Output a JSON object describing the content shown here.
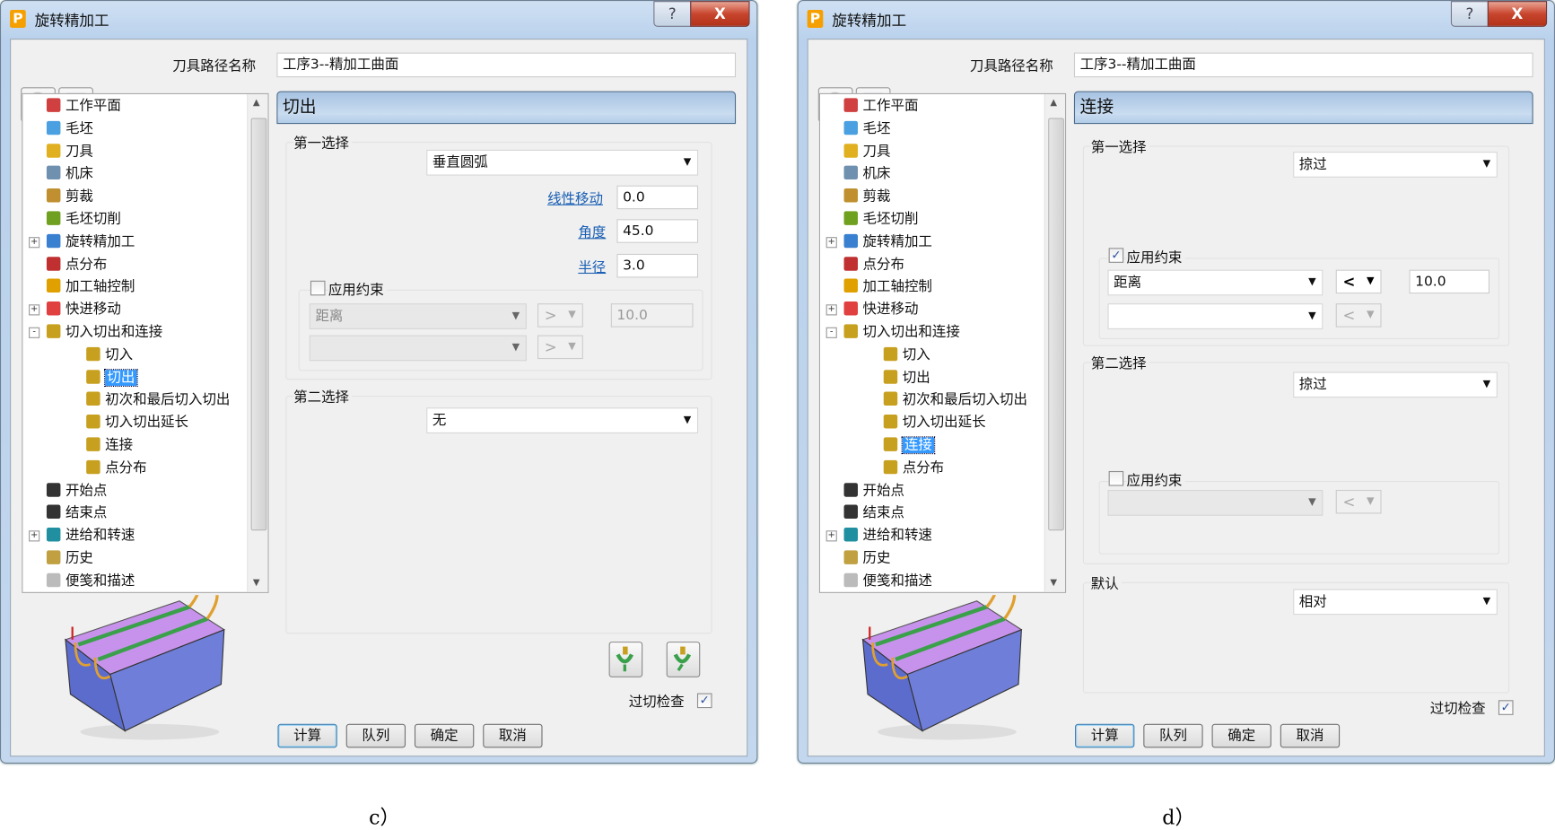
{
  "colors": {
    "accent": "#3399ff",
    "link": "#1a5fb4",
    "header": "#b3cde8"
  },
  "dialogs": [
    {
      "caption": "c）",
      "title": "旋转精加工",
      "help": "?",
      "close": "X",
      "path_label": "刀具路径名称",
      "path_value": "工序3--精加工曲面",
      "selected_index": 12,
      "header": "切出",
      "first_choice": {
        "label": "第一选择",
        "value": "垂直圆弧",
        "linear_label": "线性移动",
        "linear_value": "0.0",
        "angle_label": "角度",
        "angle_value": "45.0",
        "radius_label": "半径",
        "radius_value": "3.0",
        "constraint": {
          "label": "应用约束",
          "checked": false,
          "row1_combo": "距离",
          "row1_op": ">",
          "row1_value": "10.0",
          "row2_combo": "",
          "row2_op": ">"
        }
      },
      "second_choice": {
        "label": "第二选择",
        "value": "无"
      },
      "gouge_label": "过切检查",
      "gouge_checked": true,
      "buttons": {
        "calc": "计算",
        "queue": "队列",
        "ok": "确定",
        "cancel": "取消"
      }
    },
    {
      "caption": "d）",
      "title": "旋转精加工",
      "help": "?",
      "close": "X",
      "path_label": "刀具路径名称",
      "path_value": "工序3--精加工曲面",
      "selected_index": 14,
      "header": "连接",
      "first_choice": {
        "label": "第一选择",
        "value": "掠过",
        "constraint": {
          "label": "应用约束",
          "checked": true,
          "row1_combo": "距离",
          "row1_op": "<",
          "row1_value": "10.0",
          "row2_combo": "",
          "row2_op": "<"
        }
      },
      "second_choice": {
        "label": "第二选择",
        "value": "掠过",
        "constraint": {
          "label": "应用约束",
          "checked": false,
          "row1_combo": "",
          "row1_op": "<"
        }
      },
      "default": {
        "label": "默认",
        "value": "相对"
      },
      "gouge_label": "过切检查",
      "gouge_checked": true,
      "buttons": {
        "calc": "计算",
        "queue": "队列",
        "ok": "确定",
        "cancel": "取消"
      }
    }
  ],
  "tree": [
    {
      "label": "工作平面",
      "level": 0,
      "icon": "workplane-icon",
      "color": "#d04040"
    },
    {
      "label": "毛坯",
      "level": 0,
      "icon": "block-icon",
      "color": "#4aa0e0"
    },
    {
      "label": "刀具",
      "level": 0,
      "icon": "tool-icon",
      "color": "#e0b020"
    },
    {
      "label": "机床",
      "level": 0,
      "icon": "machine-icon",
      "color": "#7090b0"
    },
    {
      "label": "剪裁",
      "level": 0,
      "icon": "limit-icon",
      "color": "#c09030"
    },
    {
      "label": "毛坯切削",
      "level": 0,
      "icon": "stock-cut-icon",
      "color": "#70a020"
    },
    {
      "label": "旋转精加工",
      "level": 0,
      "icon": "rotary-icon",
      "color": "#3a80d0",
      "expander": "+"
    },
    {
      "label": "点分布",
      "level": 0,
      "icon": "point-distribution-icon",
      "color": "#c03030"
    },
    {
      "label": "加工轴控制",
      "level": 0,
      "icon": "axis-control-icon",
      "color": "#e0a000"
    },
    {
      "label": "快进移动",
      "level": 0,
      "icon": "rapid-move-icon",
      "color": "#e04040",
      "expander": "+"
    },
    {
      "label": "切入切出和连接",
      "level": 0,
      "icon": "leads-links-icon",
      "color": "#c8a020",
      "expander": "-"
    },
    {
      "label": "切入",
      "level": 1,
      "icon": "lead-in-icon",
      "color": "#c8a020"
    },
    {
      "label": "切出",
      "level": 1,
      "icon": "lead-out-icon",
      "color": "#c8a020"
    },
    {
      "label": "初次和最后切入切出",
      "level": 1,
      "icon": "first-last-icon",
      "color": "#c8a020"
    },
    {
      "label": "连接",
      "level": 1,
      "icon": "links-icon",
      "color": "#c8a020"
    },
    {
      "label": "点分布",
      "level": 1,
      "icon": "lead-point-icon",
      "color": "#c8a020"
    },
    {
      "label": "切入切出延长",
      "level": 1,
      "icon": "extension-icon",
      "color": "#c8a020",
      "insert_after": 13
    },
    {
      "label": "开始点",
      "level": 0,
      "icon": "start-point-icon",
      "color": "#333333"
    },
    {
      "label": "结束点",
      "level": 0,
      "icon": "end-point-icon",
      "color": "#333333"
    },
    {
      "label": "进给和转速",
      "level": 0,
      "icon": "feed-speed-icon",
      "color": "#2090a0",
      "expander": "+"
    },
    {
      "label": "历史",
      "level": 0,
      "icon": "history-icon",
      "color": "#c0a040"
    },
    {
      "label": "便笺和描述",
      "level": 0,
      "icon": "notes-icon",
      "color": "#bbbbbb"
    }
  ]
}
